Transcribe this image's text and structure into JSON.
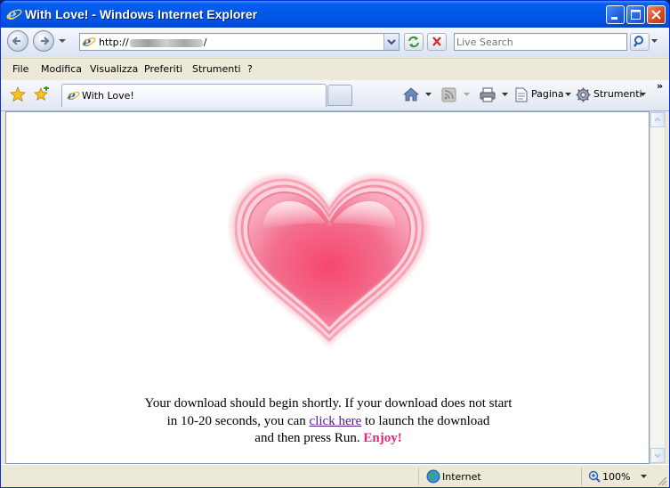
{
  "window": {
    "title": "With Love! - Windows Internet Explorer",
    "accent": "#0055e5"
  },
  "toolbar": {
    "address_prefix": "http://",
    "address_suffix": "/",
    "search_placeholder": "Live Search"
  },
  "menu": {
    "items": [
      {
        "label": "File"
      },
      {
        "label": "Modifica"
      },
      {
        "label": "Visualizza"
      },
      {
        "label": "Preferiti"
      },
      {
        "label": "Strumenti"
      },
      {
        "label": "?"
      }
    ]
  },
  "tabs": {
    "active_label": "With Love!"
  },
  "commands": {
    "page_label": "Pagina",
    "tools_label": "Strumenti",
    "more": "»"
  },
  "content": {
    "line1": "Your download should begin shortly. If your download does not start",
    "line2_before": "in 10-20 seconds, you can ",
    "link_text": "click here",
    "line2_after": " to launch the download",
    "line3_before": "and then press Run. ",
    "enjoy": "Enjoy!",
    "heart_color": "#f2557e",
    "enjoy_color": "#e8237f"
  },
  "status": {
    "zone": "Internet",
    "zoom": "100%"
  }
}
